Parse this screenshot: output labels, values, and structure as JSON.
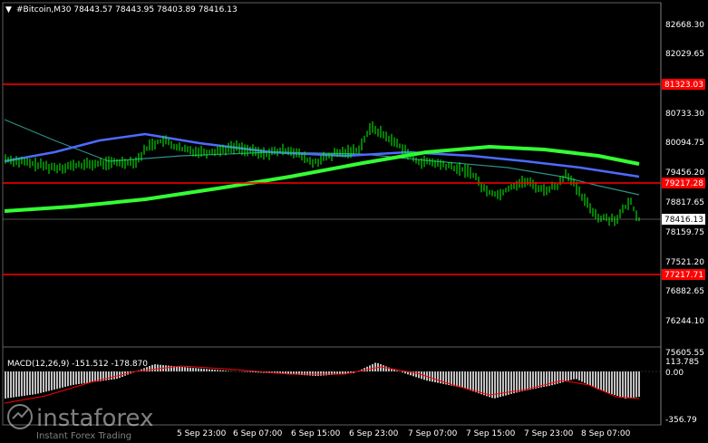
{
  "header": {
    "arrow": "▼",
    "text": "#Bitcoin,M30  78443.57 78443.95 78403.89 78416.13"
  },
  "price_axis": {
    "labels": [
      "82668.30",
      "82029.65",
      "80733.30",
      "80094.75",
      "79456.20",
      "78817.65",
      "78159.75",
      "77521.20",
      "76882.65",
      "76244.10",
      "75605.55"
    ]
  },
  "levels": [
    {
      "price": "81323.03",
      "color": "#ff0000"
    },
    {
      "price": "79217.28",
      "color": "#ff0000"
    },
    {
      "price": "77217.71",
      "color": "#ff0000"
    }
  ],
  "current_price": "78416.13",
  "time_axis": {
    "labels": [
      "5 Sep 23:00",
      "6 Sep 07:00",
      "6 Sep 15:00",
      "6 Sep 23:00",
      "7 Sep 07:00",
      "7 Sep 15:00",
      "7 Sep 23:00",
      "8 Sep 07:00"
    ]
  },
  "macd": {
    "title": "MACD(12,26,9) -151.512 -178.870",
    "axis_labels": [
      "113.785",
      "0.00",
      "-356.79"
    ]
  },
  "watermark": {
    "brand": "instaforex",
    "tagline": "Instant Forex Trading"
  },
  "colors": {
    "background": "#000000",
    "candles": "#00ff00",
    "ma_fast": "#2f8f86",
    "ma_mid": "#4d6bff",
    "ma_slow": "#33ff33",
    "level_line": "#ff0000",
    "macd_hist": "#c0c0c0",
    "macd_signal": "#ff0000"
  }
}
